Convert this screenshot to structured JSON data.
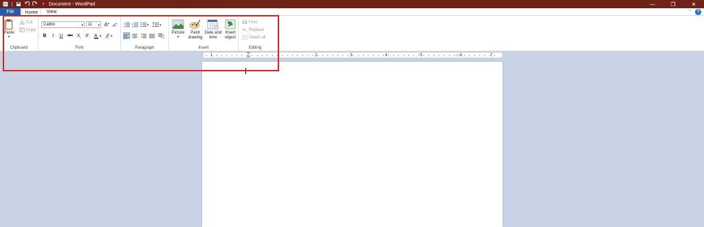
{
  "window": {
    "title": "Document - WordPad",
    "controls": [
      "minimize-icon",
      "restore-icon",
      "close-icon"
    ]
  },
  "tabs": [
    {
      "label": "File"
    },
    {
      "label": "Home"
    },
    {
      "label": "View"
    }
  ],
  "ribbon": {
    "clipboard": {
      "label": "Clipboard",
      "paste": "Paste",
      "cut": "Cut",
      "copy": "Copy"
    },
    "font": {
      "label": "Font",
      "family": "Calibri",
      "size": "11",
      "bold": "B",
      "italic": "I",
      "underline": "U",
      "strike": "abc",
      "subscript": "X",
      "superscript": "X"
    },
    "paragraph": {
      "label": "Paragraph"
    },
    "insert": {
      "label": "Insert",
      "picture": "Picture",
      "paint_line1": "Paint",
      "paint_line2": "drawing",
      "date_line1": "Date and",
      "date_line2": "time",
      "object_line1": "Insert",
      "object_line2": "object"
    },
    "editing": {
      "label": "Editing",
      "find": "Find",
      "replace": "Replace",
      "select_all": "Select all"
    }
  },
  "ruler": {
    "marks": [
      "1",
      "2",
      "3",
      "4",
      "5",
      "6",
      "7"
    ]
  },
  "colors": {
    "titlebar": "#6e2318",
    "file_tab": "#1e5fb4",
    "workspace": "#c9d3e6",
    "annotation": "#e0201b"
  }
}
